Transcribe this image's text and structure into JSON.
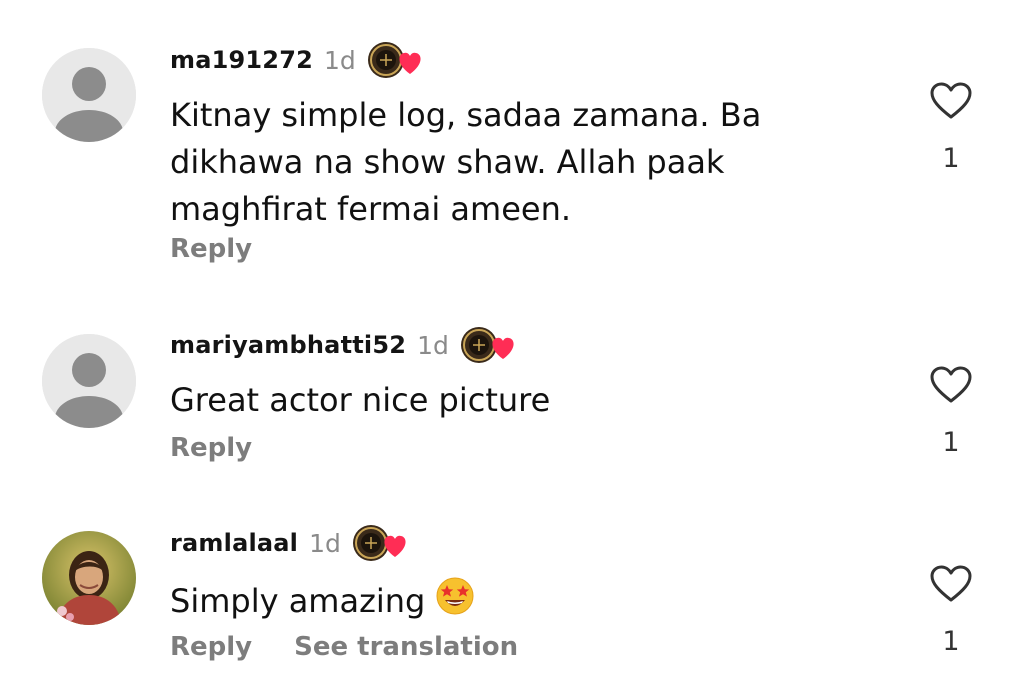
{
  "comments": [
    {
      "username": "ma191272",
      "time": "1d",
      "badge_icon": "legacy-badge-heart-icon",
      "text_lines": [
        "Kitnay simple log, sadaa zamana.  Ba",
        "dikhawa na show shaw. Allah paak",
        "maghfirat fermai ameen."
      ],
      "reply_label": "Reply",
      "like_count": "1",
      "avatar": "default-avatar"
    },
    {
      "username": "mariyambhatti52",
      "time": "1d",
      "badge_icon": "legacy-badge-heart-icon",
      "text_lines": [
        "Great actor nice picture"
      ],
      "reply_label": "Reply",
      "like_count": "1",
      "avatar": "default-avatar"
    },
    {
      "username": "ramlalaal",
      "time": "1d",
      "badge_icon": "legacy-badge-heart-icon",
      "text_lines": [
        "Simply amazing"
      ],
      "emoji": "star-struck-emoji",
      "reply_label": "Reply",
      "translate_label": "See translation",
      "like_count": "1",
      "avatar": "user-photo-avatar"
    }
  ],
  "colors": {
    "heart_red": "#ff2d55",
    "secondary_text": "#7d7d7d",
    "avatar_gray": "#8c8c8c"
  }
}
